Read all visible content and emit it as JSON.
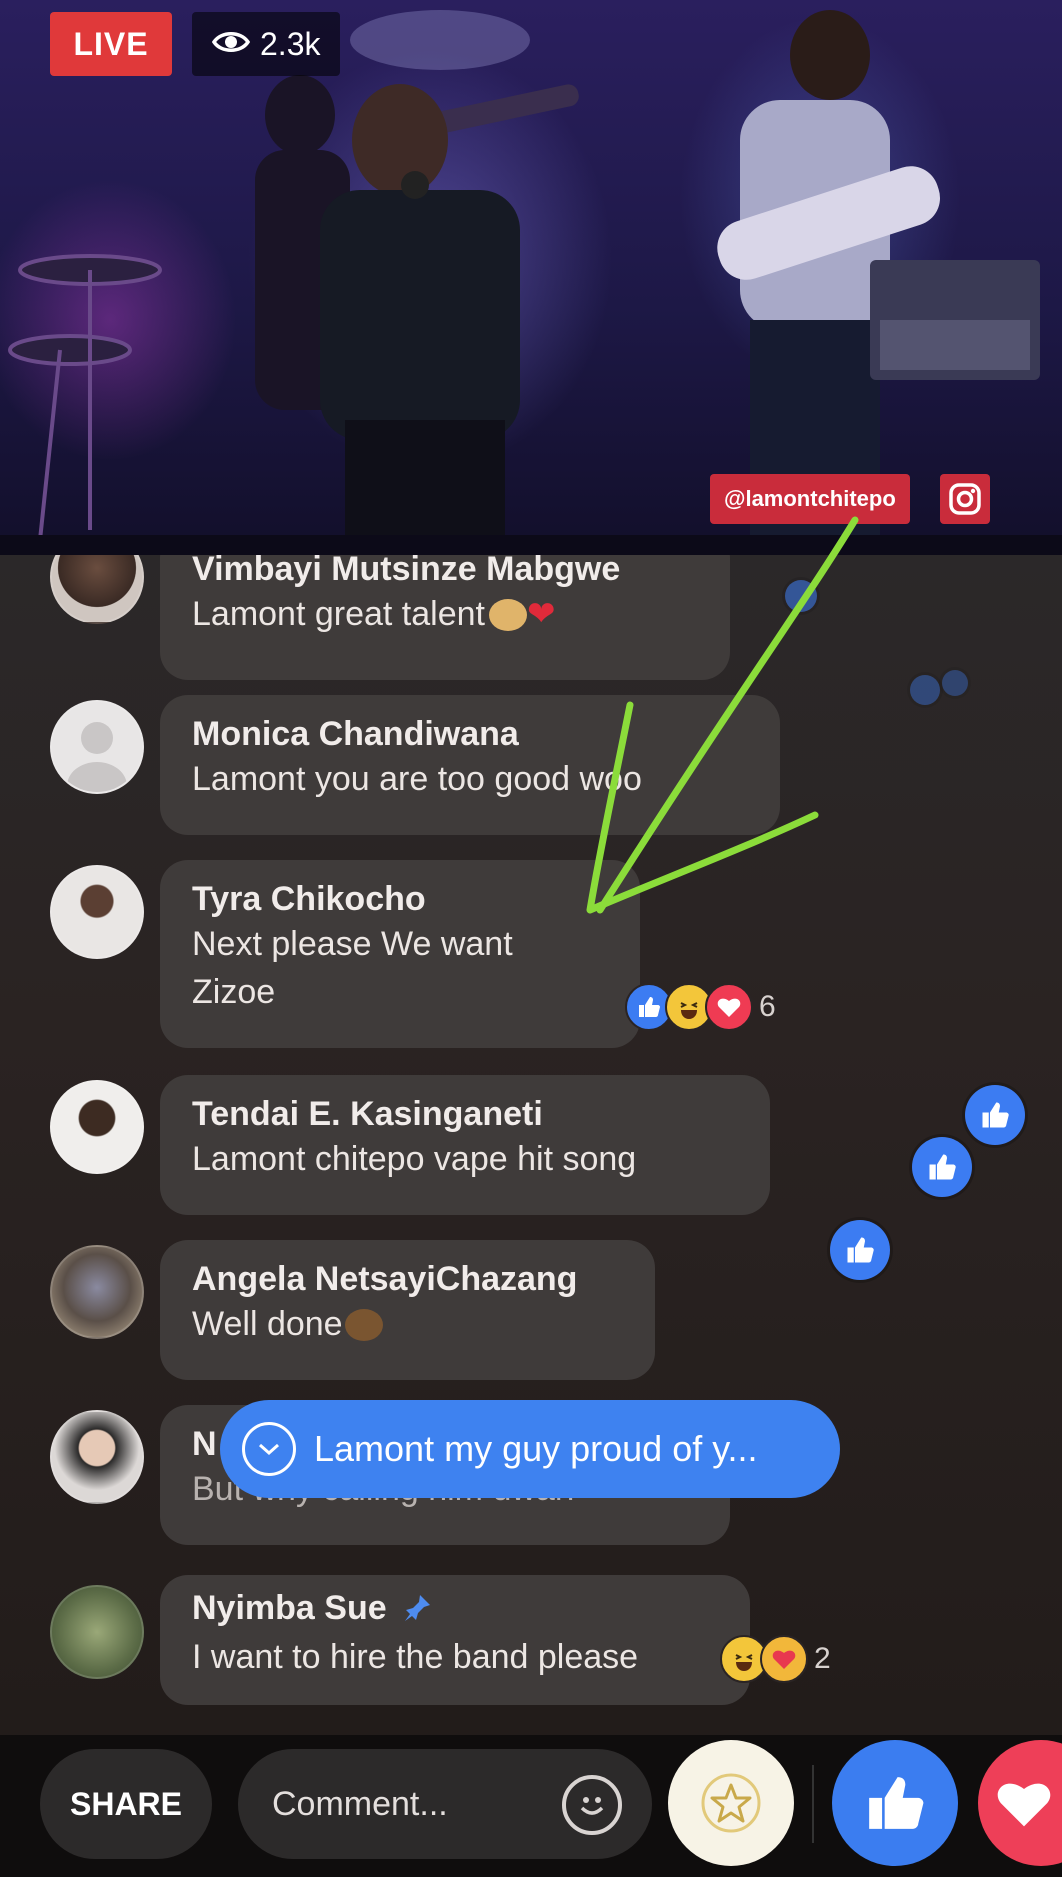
{
  "video": {
    "live_label": "LIVE",
    "viewer_count": "2.3k",
    "watermark": "@lamontchitepo"
  },
  "comments": [
    {
      "author": "Vimbayi Mutsinze Mabgwe",
      "text": "Lamont great talent",
      "emojis": [
        "clap-emoji",
        "red-heart-emoji"
      ]
    },
    {
      "author": "Monica Chandiwana",
      "text": "Lamont  you are  too good  woo",
      "avatar": "default-avatar"
    },
    {
      "author": "Tyra Chikocho",
      "text_line1": "Next please We want",
      "text_line2": "Zizoe",
      "reaction_count": "6",
      "reactions": [
        "like",
        "haha",
        "love"
      ]
    },
    {
      "author": "Tendai E. Kasinganeti",
      "text": "Lamont chitepo  vape hit song"
    },
    {
      "author": "Angela NetsayiChazang",
      "text": "Well done",
      "emojis": [
        "clap-emoji"
      ]
    },
    {
      "author": "N",
      "text": "But why calling him dwarf"
    },
    {
      "author": "Nyimba Sue",
      "text": "I want to hire the band please",
      "reaction_count": "2",
      "reactions": [
        "haha",
        "care"
      ],
      "pinned_icon": "pin-icon"
    }
  ],
  "new_comment_pill": {
    "text": "Lamont my guy proud of y..."
  },
  "bottom_bar": {
    "share_label": "SHARE",
    "comment_placeholder": "Comment..."
  },
  "colors": {
    "live_red": "#e0393a",
    "like_blue": "#3c7cf2",
    "annotation_arrow": "#8bdc3a",
    "bubble": "#3f3b3a"
  }
}
